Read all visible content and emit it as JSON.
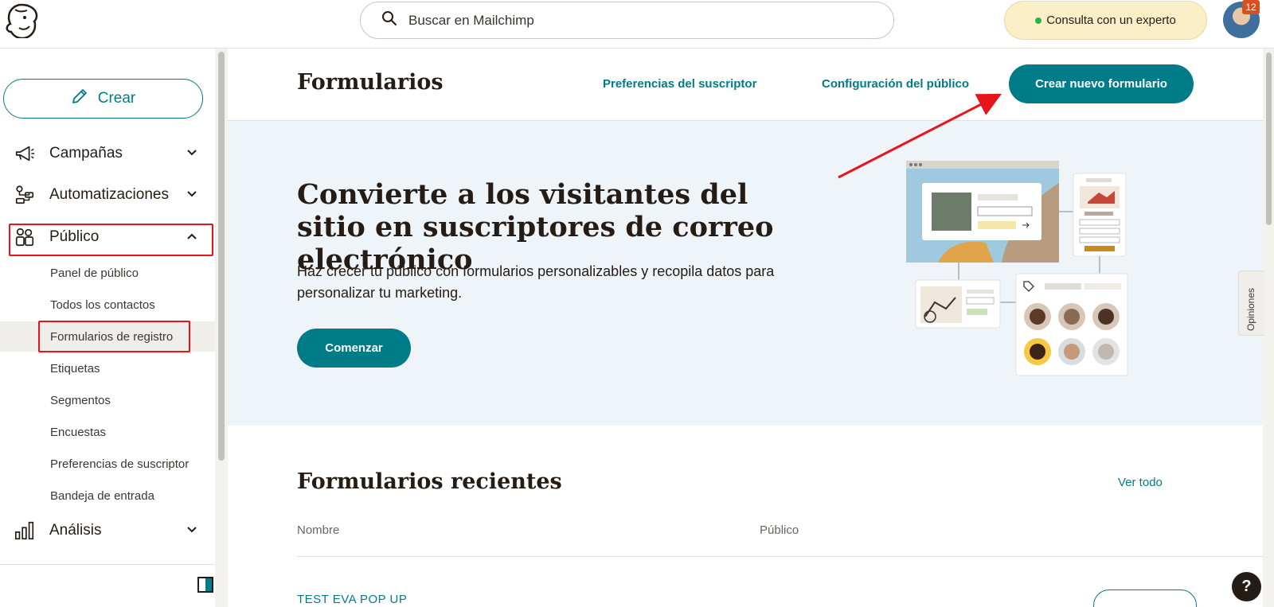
{
  "topbar": {
    "logo_icon": "mailchimp-freddie-logo",
    "search_placeholder": "Buscar en Mailchimp",
    "expert_label": "Consulta con un experto",
    "notification_count": "12"
  },
  "sidebar": {
    "create_label": "Crear",
    "items": [
      {
        "label": "Campañas",
        "icon": "megaphone-icon",
        "expanded": false
      },
      {
        "label": "Automatizaciones",
        "icon": "automation-icon",
        "expanded": false
      },
      {
        "label": "Público",
        "icon": "audience-icon",
        "expanded": true
      },
      {
        "label": "Análisis",
        "icon": "bar-chart-icon",
        "expanded": false
      }
    ],
    "sub_items": [
      "Panel de público",
      "Todos los contactos",
      "Formularios de registro",
      "Etiquetas",
      "Segmentos",
      "Encuestas",
      "Preferencias de suscriptor",
      "Bandeja de entrada"
    ],
    "active_sub_item": "Formularios de registro"
  },
  "header": {
    "title": "Formularios",
    "link_preferences": "Preferencias del suscriptor",
    "link_settings": "Configuración del público",
    "primary_button": "Crear nuevo formulario"
  },
  "hero": {
    "title": "Convierte a los visitantes del sitio en suscriptores de correo electrónico",
    "description": "Haz crecer tu público con formularios personalizables y recopila datos para personalizar tu marketing.",
    "button": "Comenzar"
  },
  "recent": {
    "title": "Formularios recientes",
    "see_all": "Ver todo",
    "columns": [
      "Nombre",
      "Público"
    ],
    "rows": [
      {
        "name": "TEST EVA POP UP"
      }
    ]
  },
  "feedback_label": "Opiniones",
  "help_label": "?",
  "colors": {
    "accent": "#007c89",
    "annotation": "#e8141b",
    "hero_bg": "#eef4f8",
    "expert_bg": "#fbefc8"
  }
}
